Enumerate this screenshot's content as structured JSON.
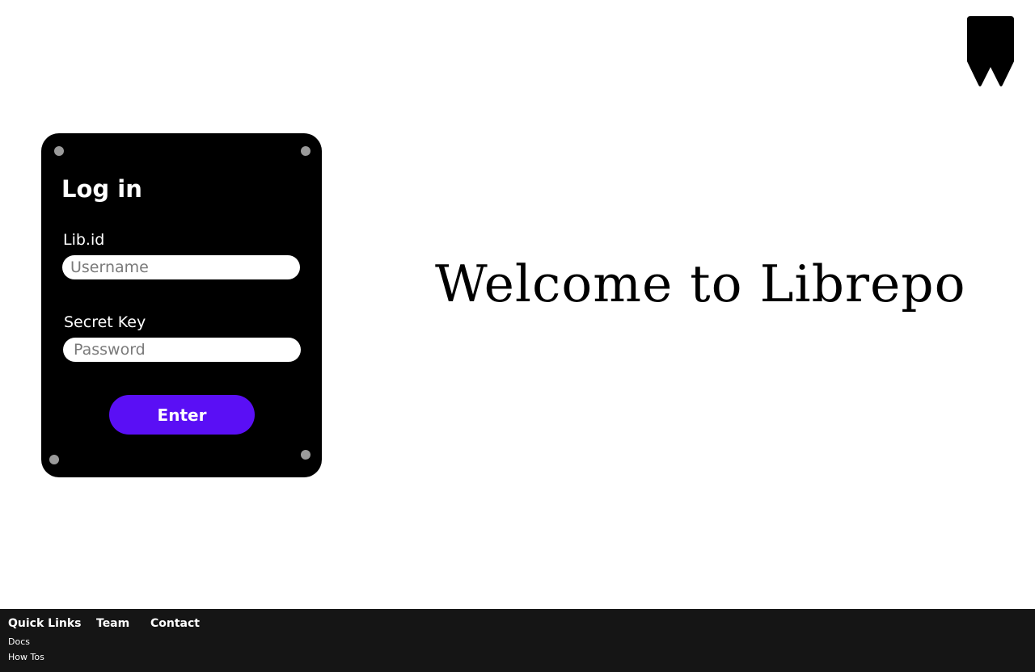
{
  "logo": {
    "icon": "bookmark-icon",
    "color": "#000000"
  },
  "login": {
    "title": "Log in",
    "username_label": "Lib.id",
    "username_placeholder": "Username",
    "password_label": "Secret Key",
    "password_placeholder": "Password",
    "submit_label": "Enter",
    "card_color": "#000000",
    "accent_color": "#5a0ff5"
  },
  "welcome": {
    "heading": "Welcome to Librepo"
  },
  "footer": {
    "background": "#151515",
    "quick_links": {
      "heading": "Quick Links",
      "items": [
        "Docs",
        "How Tos"
      ]
    },
    "team": "Team",
    "contact": "Contact"
  }
}
